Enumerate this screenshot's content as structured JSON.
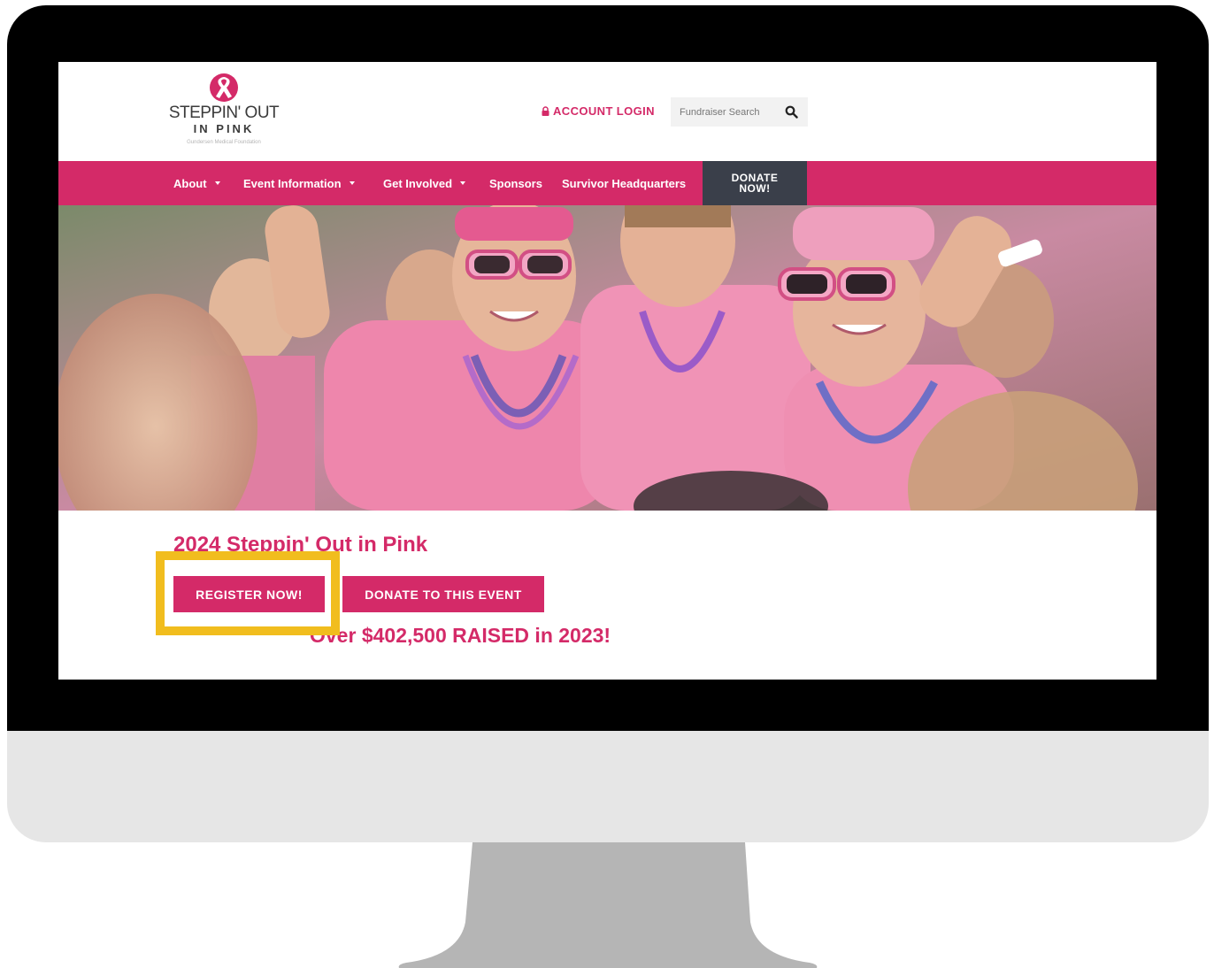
{
  "site": {
    "logo": {
      "line1": "STEPPIN' OUT",
      "line2": "IN PINK",
      "line3": "Gundersen Medical Foundation",
      "icon": "pink-ribbon-icon"
    },
    "account_login": "ACCOUNT LOGIN",
    "search_placeholder": "Fundraiser Search",
    "colors": {
      "brand_pink": "#d42a68",
      "nav_dark": "#3a3f4a",
      "highlight": "#f1bd1e"
    }
  },
  "nav": {
    "items": [
      {
        "label": "About",
        "has_dropdown": true
      },
      {
        "label": "Event Information",
        "has_dropdown": true
      },
      {
        "label": "Get Involved",
        "has_dropdown": true
      },
      {
        "label": "Sponsors",
        "has_dropdown": false
      },
      {
        "label": "Survivor Headquarters",
        "has_dropdown": false
      }
    ],
    "donate_line1": "DONATE",
    "donate_line2": "NOW!"
  },
  "event": {
    "title": "2024 Steppin' Out in Pink",
    "register_button": "REGISTER NOW!",
    "donate_button": "DONATE TO THIS EVENT",
    "raised_text": "Over $402,500 RAISED in 2023!"
  }
}
